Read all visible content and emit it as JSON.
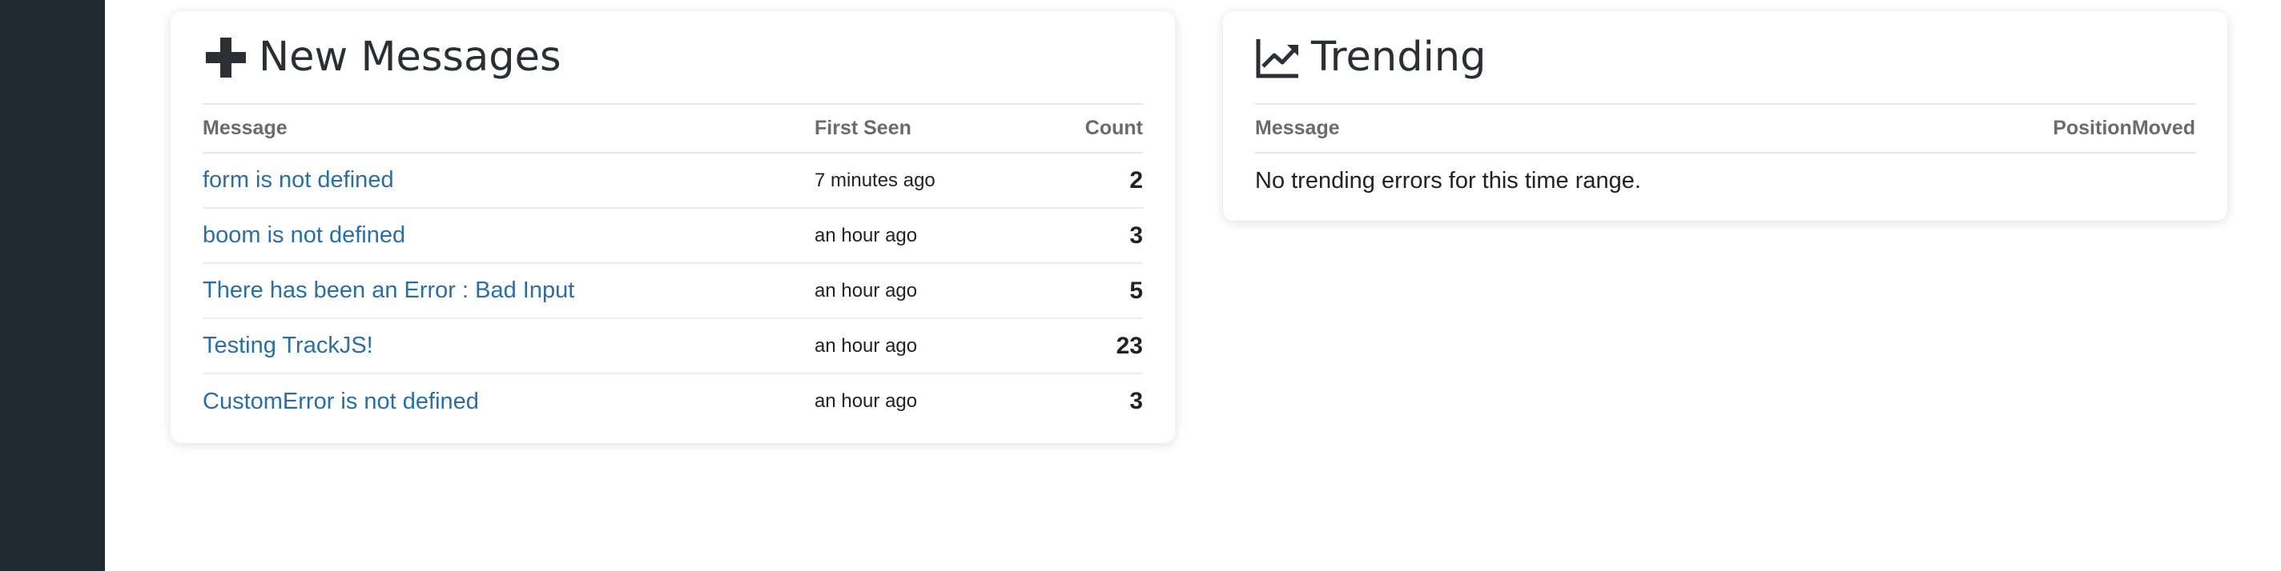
{
  "new_messages": {
    "title": "New Messages",
    "icon": "plus-icon",
    "columns": {
      "message": "Message",
      "first_seen": "First Seen",
      "count": "Count"
    },
    "rows": [
      {
        "message": "form is not defined",
        "first_seen": "7 minutes ago",
        "count": "2"
      },
      {
        "message": "boom is not defined",
        "first_seen": "an hour ago",
        "count": "3"
      },
      {
        "message": "There has been an Error : Bad Input",
        "first_seen": "an hour ago",
        "count": "5"
      },
      {
        "message": "Testing TrackJS!",
        "first_seen": "an hour ago",
        "count": "23"
      },
      {
        "message": "CustomError is not defined",
        "first_seen": "an hour ago",
        "count": "3"
      }
    ]
  },
  "trending": {
    "title": "Trending",
    "icon": "line-chart-icon",
    "columns": {
      "message": "Message",
      "position": "Position",
      "moved": "Moved"
    },
    "empty_text": "No trending errors for this time range."
  },
  "colors": {
    "sidebar": "#222b33",
    "link": "#2a6ea6",
    "header_text": "#6b6b6b"
  }
}
